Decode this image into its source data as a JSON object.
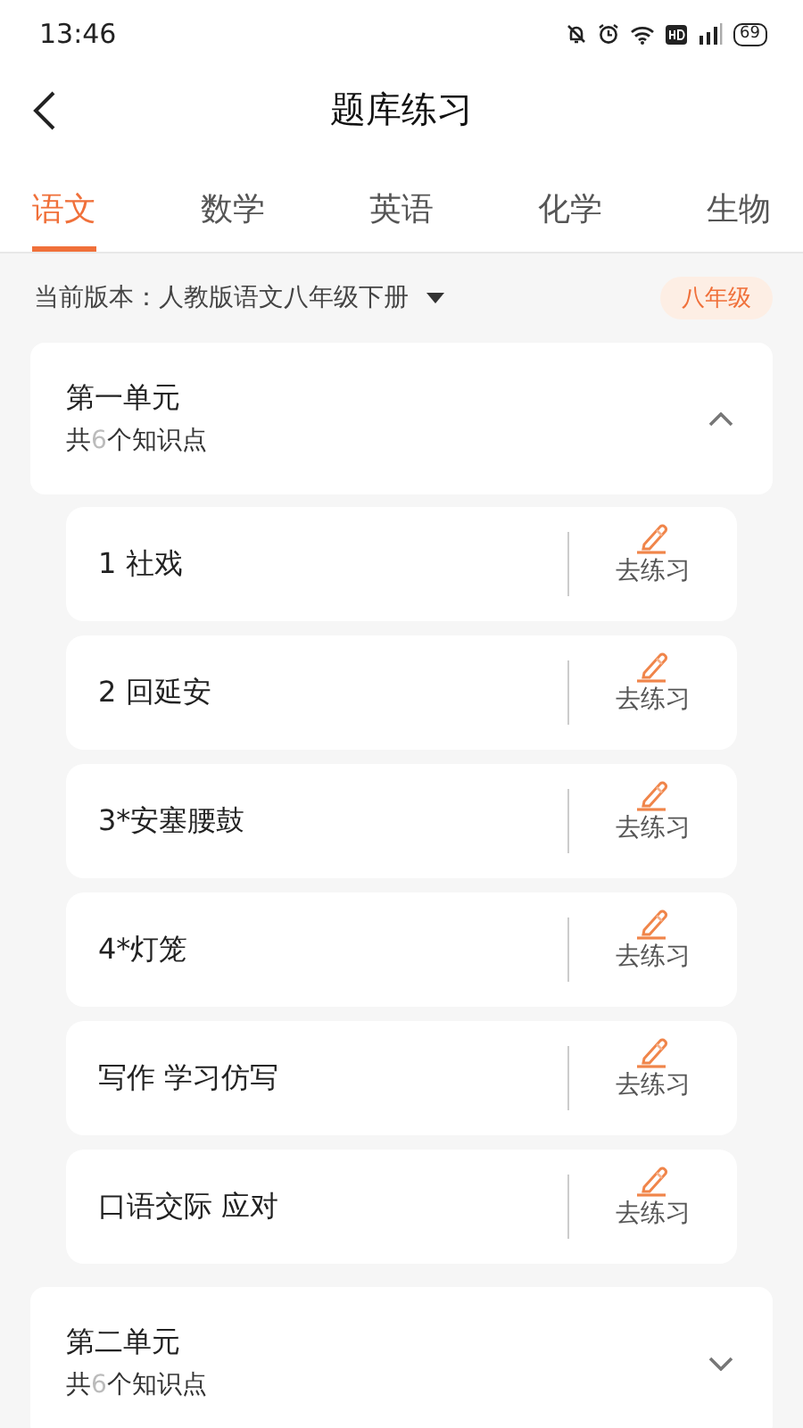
{
  "status_bar": {
    "time": "13:46",
    "battery": "69"
  },
  "header": {
    "title": "题库练习"
  },
  "tabs": [
    {
      "label": "语文",
      "selected": true
    },
    {
      "label": "数学",
      "selected": false
    },
    {
      "label": "英语",
      "selected": false
    },
    {
      "label": "化学",
      "selected": false
    },
    {
      "label": "生物",
      "selected": false
    }
  ],
  "version": {
    "label": "当前版本：人教版语文八年级下册",
    "grade": "八年级"
  },
  "units": [
    {
      "title": "第一单元",
      "count_prefix": "共",
      "count": "6",
      "count_suffix": "个知识点",
      "expanded": true,
      "lessons": [
        {
          "title": "1 社戏",
          "action": "去练习"
        },
        {
          "title": "2 回延安",
          "action": "去练习"
        },
        {
          "title": "3*安塞腰鼓",
          "action": "去练习"
        },
        {
          "title": "4*灯笼",
          "action": "去练习"
        },
        {
          "title": "写作 学习仿写",
          "action": "去练习"
        },
        {
          "title": "口语交际 应对",
          "action": "去练习"
        }
      ]
    },
    {
      "title": "第二单元",
      "count_prefix": "共",
      "count": "6",
      "count_suffix": "个知识点",
      "expanded": false
    }
  ]
}
